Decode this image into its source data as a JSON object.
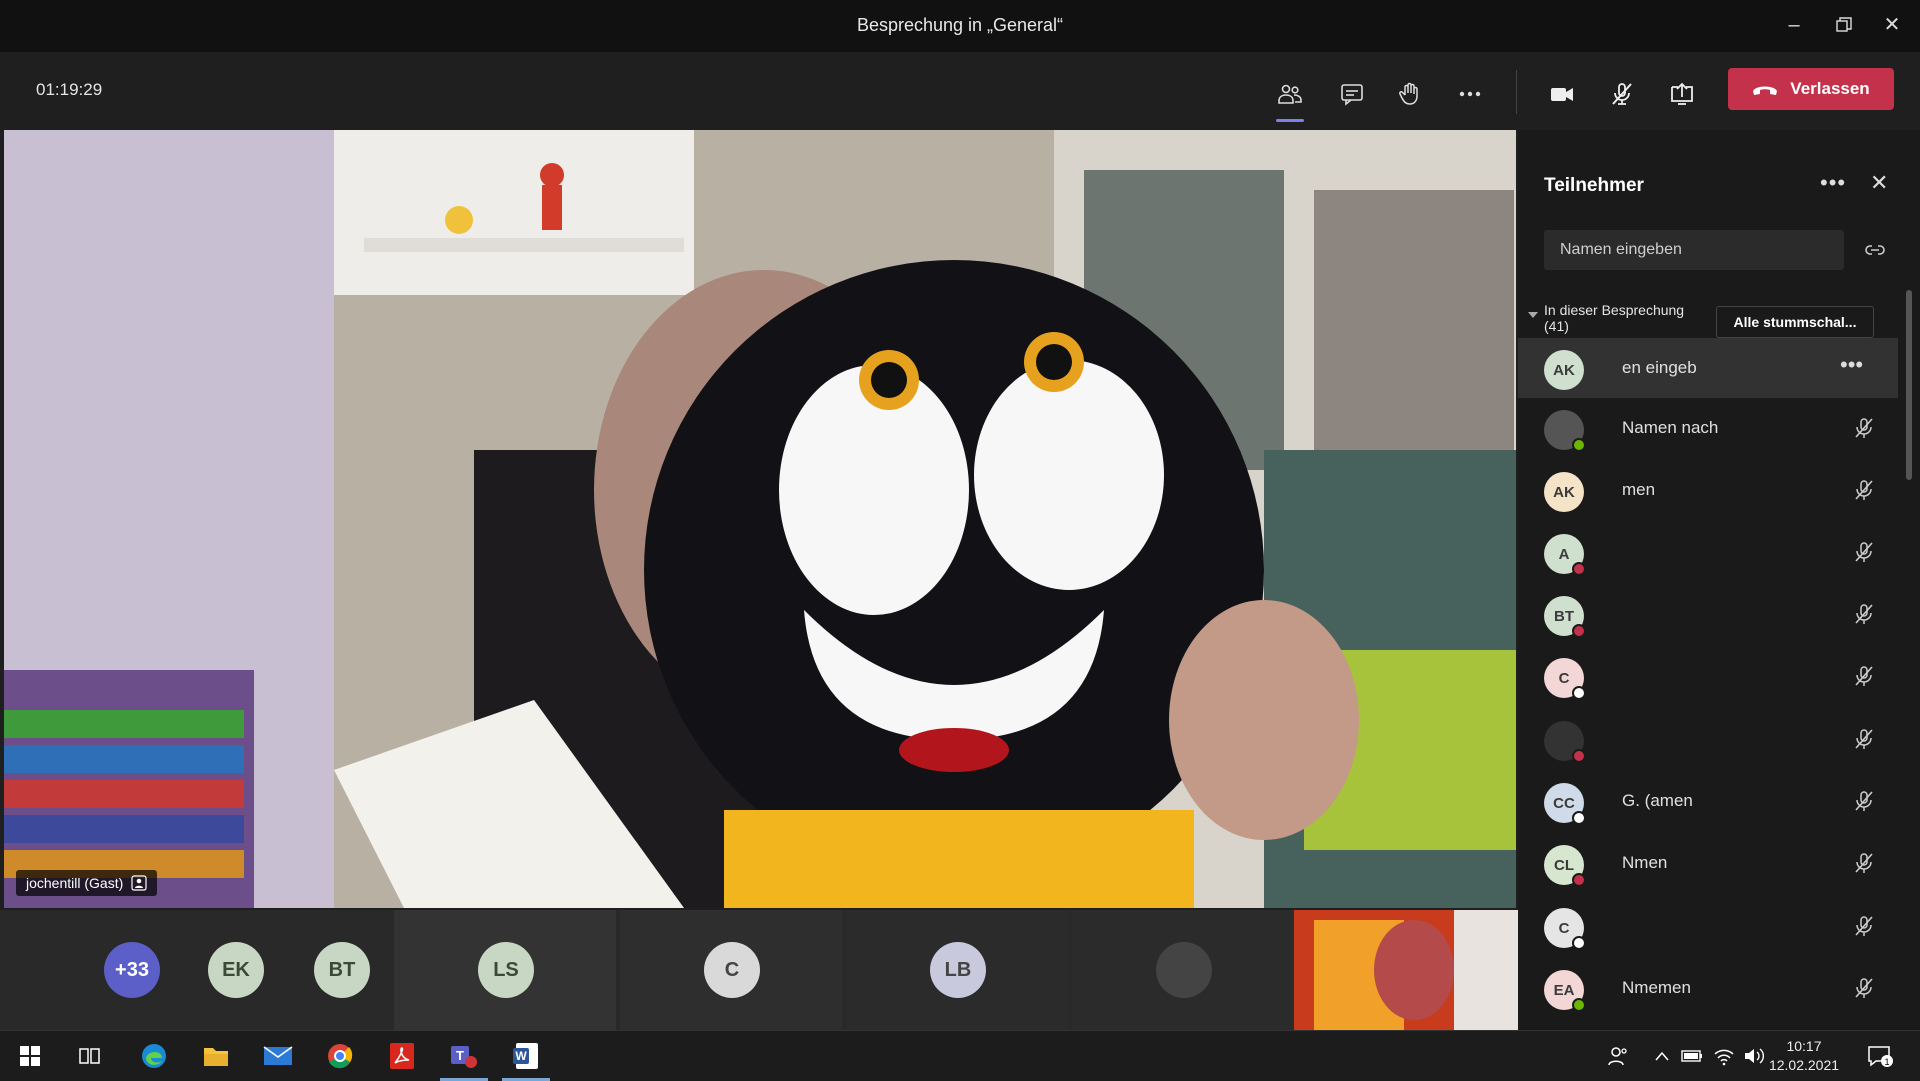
{
  "window": {
    "title": "Besprechung in „General“"
  },
  "toolbar": {
    "timer": "01:19:29",
    "leave_label": "Verlassen"
  },
  "video": {
    "name_tag": "jochentill (Gast)"
  },
  "strip": {
    "overflow": "+33",
    "tiles": [
      "EK",
      "BT",
      "LS",
      "C",
      "LB"
    ]
  },
  "panel": {
    "title": "Teilnehmer",
    "search_placeholder": "Namen eingeben",
    "section_label": "In dieser Besprechung",
    "section_count": "(41)",
    "mute_all": "Alle stummschal...",
    "participants": [
      {
        "initials": "AK",
        "name": "en eingeb"
      },
      {
        "initials": "",
        "name": "Namen    nach"
      },
      {
        "initials": "AK",
        "name": "men"
      },
      {
        "initials": "A",
        "name": ""
      },
      {
        "initials": "BT",
        "name": ""
      },
      {
        "initials": "C",
        "name": ""
      },
      {
        "initials": "",
        "name": ""
      },
      {
        "initials": "CC",
        "name": "G. (amen"
      },
      {
        "initials": "CL",
        "name": "Nmen"
      },
      {
        "initials": "C",
        "name": ""
      },
      {
        "initials": "EA",
        "name": "Nmemen"
      }
    ]
  },
  "taskbar": {
    "time": "10:17",
    "date": "12.02.2021",
    "notif_count": "1"
  },
  "colors": {
    "accent": "#7b83eb",
    "leave": "#c4314b",
    "busy": "#c4314b",
    "available": "#6bb700"
  }
}
